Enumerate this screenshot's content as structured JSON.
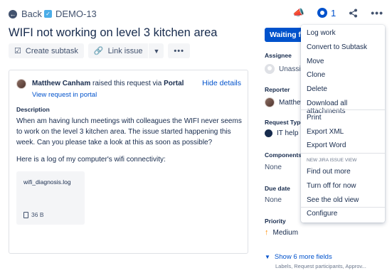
{
  "topbar": {
    "back_label": "Back",
    "issue_key": "DEMO-13",
    "watch_count": "1"
  },
  "issue": {
    "title": "WIFI not working on level 3 kitchen area"
  },
  "actions": {
    "create_subtask": "Create subtask",
    "link_issue": "Link issue"
  },
  "request": {
    "requester": "Matthew Canham",
    "raised_text": " raised this request via ",
    "channel": "Portal",
    "view_link": "View request in portal",
    "hide_details": "Hide details"
  },
  "description": {
    "label": "Description",
    "para1": "When am having lunch meetings with colleagues the WIFI never seems to work on the level 3 kitchen area. The issue started happening this week. Can you please take a look at this as soon as possible?",
    "para2": "Here is a log of my computer's wifi connectivity:"
  },
  "attachment": {
    "file_name": "wifi_diagnosis.log",
    "file_size": "36 B"
  },
  "status": {
    "label": "Waiting for support"
  },
  "fields": {
    "assignee_label": "Assignee",
    "assignee_value": "Unassigned",
    "reporter_label": "Reporter",
    "reporter_value": "Matthew Canham",
    "request_type_label": "Request Type",
    "request_type_value": "IT help",
    "components_label": "Components",
    "components_value": "None",
    "due_date_label": "Due date",
    "due_date_value": "None",
    "priority_label": "Priority",
    "priority_value": "Medium",
    "show_more": "Show 6 more fields",
    "show_more_sub": "Labels, Request participants, Approv..."
  },
  "menu": {
    "items": [
      "Log work",
      "Convert to Subtask",
      "Move",
      "Clone",
      "Delete",
      "Download all attachments",
      "Print",
      "Export XML",
      "Export Word"
    ],
    "section_header": "NEW JIRA ISSUE VIEW",
    "section_items": [
      "Find out more",
      "Turn off for now",
      "See the old view"
    ],
    "configure": "Configure"
  },
  "colors": {
    "primary": "#0052cc",
    "text": "#172b4d",
    "muted": "#42526e",
    "priority_medium": "#ff8b00"
  }
}
